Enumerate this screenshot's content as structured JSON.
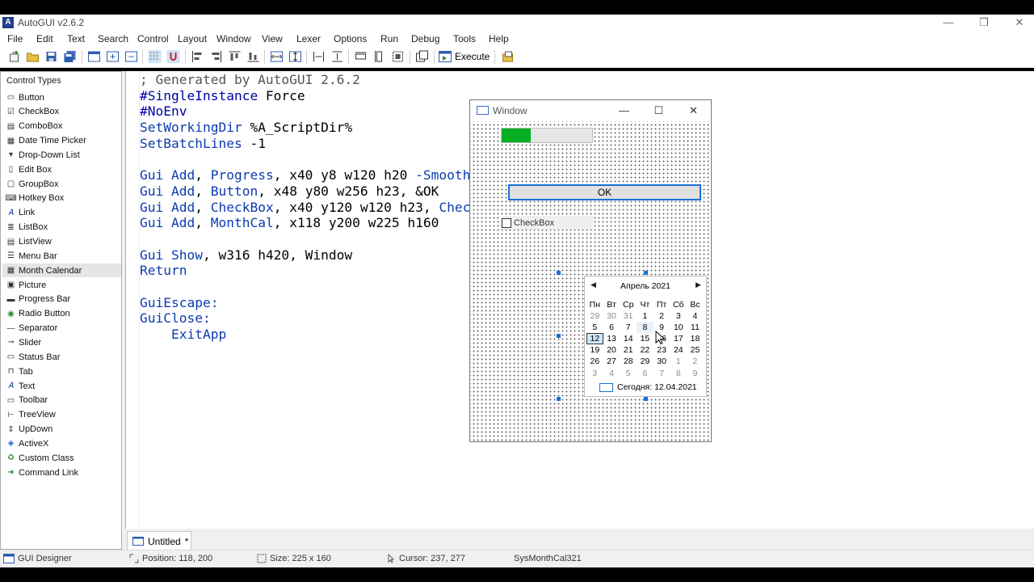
{
  "app": {
    "title": "AutoGUI v2.6.2",
    "icon_letter": "A",
    "minimize": "—",
    "restore": "❐",
    "close": "✕"
  },
  "menu": [
    "File",
    "Edit",
    "Text",
    "Search",
    "Control",
    "Layout",
    "Window",
    "View",
    "Lexer",
    "Options",
    "Run",
    "Debug",
    "Tools",
    "Help"
  ],
  "toolbar": {
    "execute_label": "Execute"
  },
  "control_types": {
    "header": "Control Types",
    "items": [
      {
        "label": "Button",
        "icon": "button-icon"
      },
      {
        "label": "CheckBox",
        "icon": "checkbox-icon"
      },
      {
        "label": "ComboBox",
        "icon": "combobox-icon"
      },
      {
        "label": "Date Time Picker",
        "icon": "datetime-icon"
      },
      {
        "label": "Drop-Down List",
        "icon": "dropdown-icon"
      },
      {
        "label": "Edit Box",
        "icon": "editbox-icon"
      },
      {
        "label": "GroupBox",
        "icon": "groupbox-icon"
      },
      {
        "label": "Hotkey Box",
        "icon": "hotkey-icon"
      },
      {
        "label": "Link",
        "icon": "link-icon"
      },
      {
        "label": "ListBox",
        "icon": "listbox-icon"
      },
      {
        "label": "ListView",
        "icon": "listview-icon"
      },
      {
        "label": "Menu Bar",
        "icon": "menubar-icon"
      },
      {
        "label": "Month Calendar",
        "icon": "calendar-icon"
      },
      {
        "label": "Picture",
        "icon": "picture-icon"
      },
      {
        "label": "Progress Bar",
        "icon": "progress-icon"
      },
      {
        "label": "Radio Button",
        "icon": "radio-icon"
      },
      {
        "label": "Separator",
        "icon": "separator-icon"
      },
      {
        "label": "Slider",
        "icon": "slider-icon"
      },
      {
        "label": "Status Bar",
        "icon": "statusbar-icon"
      },
      {
        "label": "Tab",
        "icon": "tab-icon"
      },
      {
        "label": "Text",
        "icon": "text-icon"
      },
      {
        "label": "Toolbar",
        "icon": "toolbar-icon"
      },
      {
        "label": "TreeView",
        "icon": "treeview-icon"
      },
      {
        "label": "UpDown",
        "icon": "updown-icon"
      },
      {
        "label": "ActiveX",
        "icon": "activex-icon"
      },
      {
        "label": "Custom Class",
        "icon": "customclass-icon"
      },
      {
        "label": "Command Link",
        "icon": "commandlink-icon"
      }
    ],
    "selected": "Month Calendar"
  },
  "code_lines": [
    [
      [
        "c-com",
        "; Generated by AutoGUI 2.6.2"
      ]
    ],
    [
      [
        "c-dir",
        "#SingleInstance"
      ],
      [
        "c-plain",
        " Force"
      ]
    ],
    [
      [
        "c-dir",
        "#NoEnv"
      ]
    ],
    [
      [
        "c-cmd",
        "SetWorkingDir"
      ],
      [
        "c-plain",
        " %A_ScriptDir%"
      ]
    ],
    [
      [
        "c-cmd",
        "SetBatchLines"
      ],
      [
        "c-plain",
        " -1"
      ]
    ],
    [
      [
        "c-plain",
        ""
      ]
    ],
    [
      [
        "c-cmd",
        "Gui Add"
      ],
      [
        "c-plain",
        ", "
      ],
      [
        "c-cmd",
        "Progress"
      ],
      [
        "c-plain",
        ", x40 y8 w120 h20 "
      ],
      [
        "c-cmd",
        "-Smooth"
      ]
    ],
    [
      [
        "c-cmd",
        "Gui Add"
      ],
      [
        "c-plain",
        ", "
      ],
      [
        "c-cmd",
        "Button"
      ],
      [
        "c-plain",
        ", x48 y80 w256 h23, &OK"
      ]
    ],
    [
      [
        "c-cmd",
        "Gui Add"
      ],
      [
        "c-plain",
        ", "
      ],
      [
        "c-cmd",
        "CheckBox"
      ],
      [
        "c-plain",
        ", x40 y120 w120 h23, "
      ],
      [
        "c-cmd",
        "CheckBox"
      ]
    ],
    [
      [
        "c-cmd",
        "Gui Add"
      ],
      [
        "c-plain",
        ", "
      ],
      [
        "c-cmd",
        "MonthCal"
      ],
      [
        "c-plain",
        ", x118 y200 w225 h160"
      ]
    ],
    [
      [
        "c-plain",
        ""
      ]
    ],
    [
      [
        "c-cmd",
        "Gui Show"
      ],
      [
        "c-plain",
        ", w316 h420, Window"
      ]
    ],
    [
      [
        "c-cmd",
        "Return"
      ]
    ],
    [
      [
        "c-plain",
        ""
      ]
    ],
    [
      [
        "c-lbl",
        "GuiEscape:"
      ]
    ],
    [
      [
        "c-lbl",
        "GuiClose:"
      ]
    ],
    [
      [
        "c-plain",
        "    "
      ],
      [
        "c-cmd",
        "ExitApp"
      ]
    ]
  ],
  "tab": {
    "label": "Untitled",
    "modified": "*"
  },
  "status": {
    "designer": "GUI Designer",
    "position": "Position: 118, 200",
    "size": "Size: 225 x 160",
    "cursor": "Cursor: 237, 277",
    "control_class": "SysMonthCal321"
  },
  "preview_window": {
    "title": "Window",
    "progress_fraction": 0.32,
    "progress_color": "#06b025",
    "ok_label": "OK",
    "checkbox_label": "CheckBox",
    "calendar": {
      "month_label": "Апрель 2021",
      "weekdays": [
        "Пн",
        "Вт",
        "Ср",
        "Чт",
        "Пт",
        "Сб",
        "Вс"
      ],
      "weeks": [
        [
          "29",
          "30",
          "31",
          "1",
          "2",
          "3",
          "4"
        ],
        [
          "5",
          "6",
          "7",
          "8",
          "9",
          "10",
          "11"
        ],
        [
          "12",
          "13",
          "14",
          "15",
          "16",
          "17",
          "18"
        ],
        [
          "19",
          "20",
          "21",
          "22",
          "23",
          "24",
          "25"
        ],
        [
          "26",
          "27",
          "28",
          "29",
          "30",
          "1",
          "2"
        ],
        [
          "3",
          "4",
          "5",
          "6",
          "7",
          "8",
          "9"
        ]
      ],
      "today_label": "Сегодня: 12.04.2021"
    }
  }
}
